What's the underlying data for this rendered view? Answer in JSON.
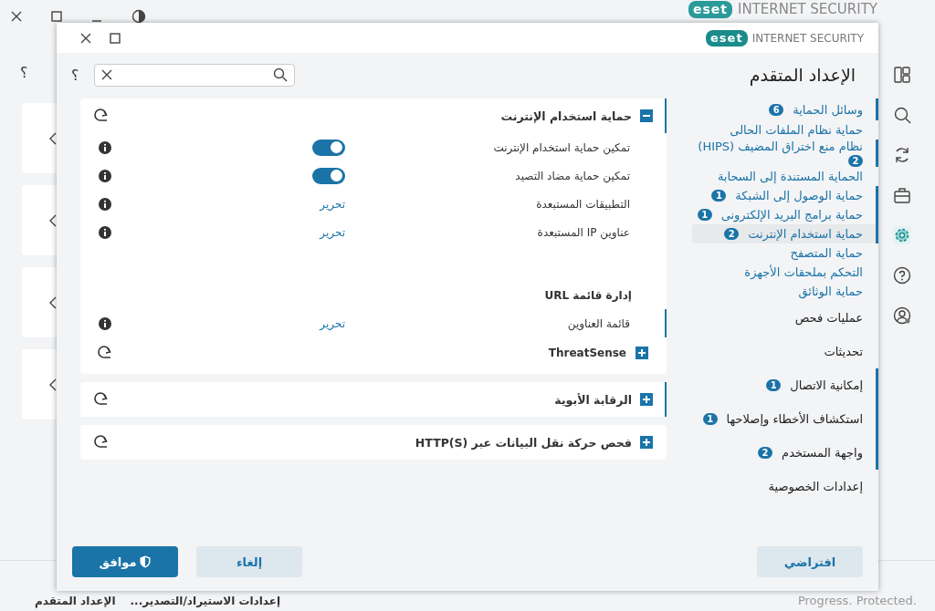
{
  "app": {
    "brand": "INTERNET SECURITY",
    "logo": "eset",
    "help": "؟",
    "status": "Progress. Protected.",
    "footer_links": [
      "إعدادات الاستيراد/التصدير...",
      "الإعداد المتقدم"
    ],
    "nav": [
      {
        "selected": false
      },
      {
        "selected": false
      },
      {
        "selected": false
      },
      {
        "selected": false
      },
      {
        "selected": true
      },
      {
        "selected": false
      },
      {
        "selected": false
      }
    ]
  },
  "dialog": {
    "logo": "eset",
    "brand": "INTERNET SECURITY",
    "help": "؟",
    "title": "الإعداد المتقدم"
  },
  "sidebar": [
    {
      "label": "وسائل الحماية",
      "badge": "6",
      "changed": true,
      "selected": false,
      "children": [
        {
          "label": "حماية نظام الملفات الحالى",
          "changed": false,
          "selected": false
        },
        {
          "label": "نظام منع اختراق المضيف (HIPS)",
          "badge": "2",
          "changed": true,
          "selected": false
        },
        {
          "label": "الحماية المستندة إلى السحابة",
          "changed": false,
          "selected": false
        },
        {
          "label": "حماية الوصول إلى الشبكة",
          "badge": "1",
          "changed": true,
          "selected": false
        },
        {
          "label": "حماية برامج البريد الإلكترونى",
          "badge": "1",
          "changed": true,
          "selected": false
        },
        {
          "label": "حماية استخدام الإنترنت",
          "badge": "2",
          "changed": true,
          "selected": true
        },
        {
          "label": "حماية المتصفح",
          "changed": false,
          "selected": false
        },
        {
          "label": "التحكم بملحقات الأجهزة",
          "changed": false,
          "selected": false
        },
        {
          "label": "حماية الوثائق",
          "changed": false,
          "selected": false
        }
      ]
    },
    {
      "label": "عمليات فحص",
      "changed": false,
      "selected": false
    },
    {
      "label": "تحديثات",
      "changed": false,
      "selected": false
    },
    {
      "label": "إمكانية الاتصال",
      "badge": "1",
      "changed": true,
      "selected": false
    },
    {
      "label": "استكشاف الأخطاء وإصلاحها",
      "badge": "1",
      "changed": true,
      "selected": false
    },
    {
      "label": "واجهة المستخدم",
      "badge": "2",
      "changed": true,
      "selected": false
    },
    {
      "label": "إعدادات الخصوصية",
      "changed": false,
      "selected": false
    }
  ],
  "sections": [
    {
      "title": "حماية استخدام الإنترنت",
      "expanded": true,
      "changed": true,
      "rows": [
        {
          "kind": "toggle",
          "label": "تمكين حماية استخدام الإنترنت",
          "on": true,
          "changed": false
        },
        {
          "kind": "toggle",
          "label": "تمكين حماية مضاد التصيد",
          "on": true,
          "changed": false
        },
        {
          "kind": "link",
          "label": "التطبيقات المستبعدة",
          "link": "تحرير",
          "changed": false
        },
        {
          "kind": "link",
          "label": "عناوين IP المستبعدة",
          "link": "تحرير",
          "changed": false
        },
        {
          "kind": "heading",
          "label": "إدارة قائمة URL"
        },
        {
          "kind": "link",
          "label": "قائمة العناوين",
          "link": "تحرير",
          "changed": true
        },
        {
          "kind": "subsection",
          "label": "ThreatSense",
          "expanded": false
        }
      ]
    },
    {
      "title": "الرقابة الأبوية",
      "expanded": false,
      "changed": true
    },
    {
      "title": "فحص حركة نقل البيانات عبر HTTP(S)",
      "expanded": false,
      "changed": false
    }
  ],
  "buttons": [
    {
      "label": "إلغاء",
      "kind": "secondary"
    },
    {
      "label": "موافق",
      "kind": "primary"
    }
  ],
  "default_button": "افتراضي"
}
